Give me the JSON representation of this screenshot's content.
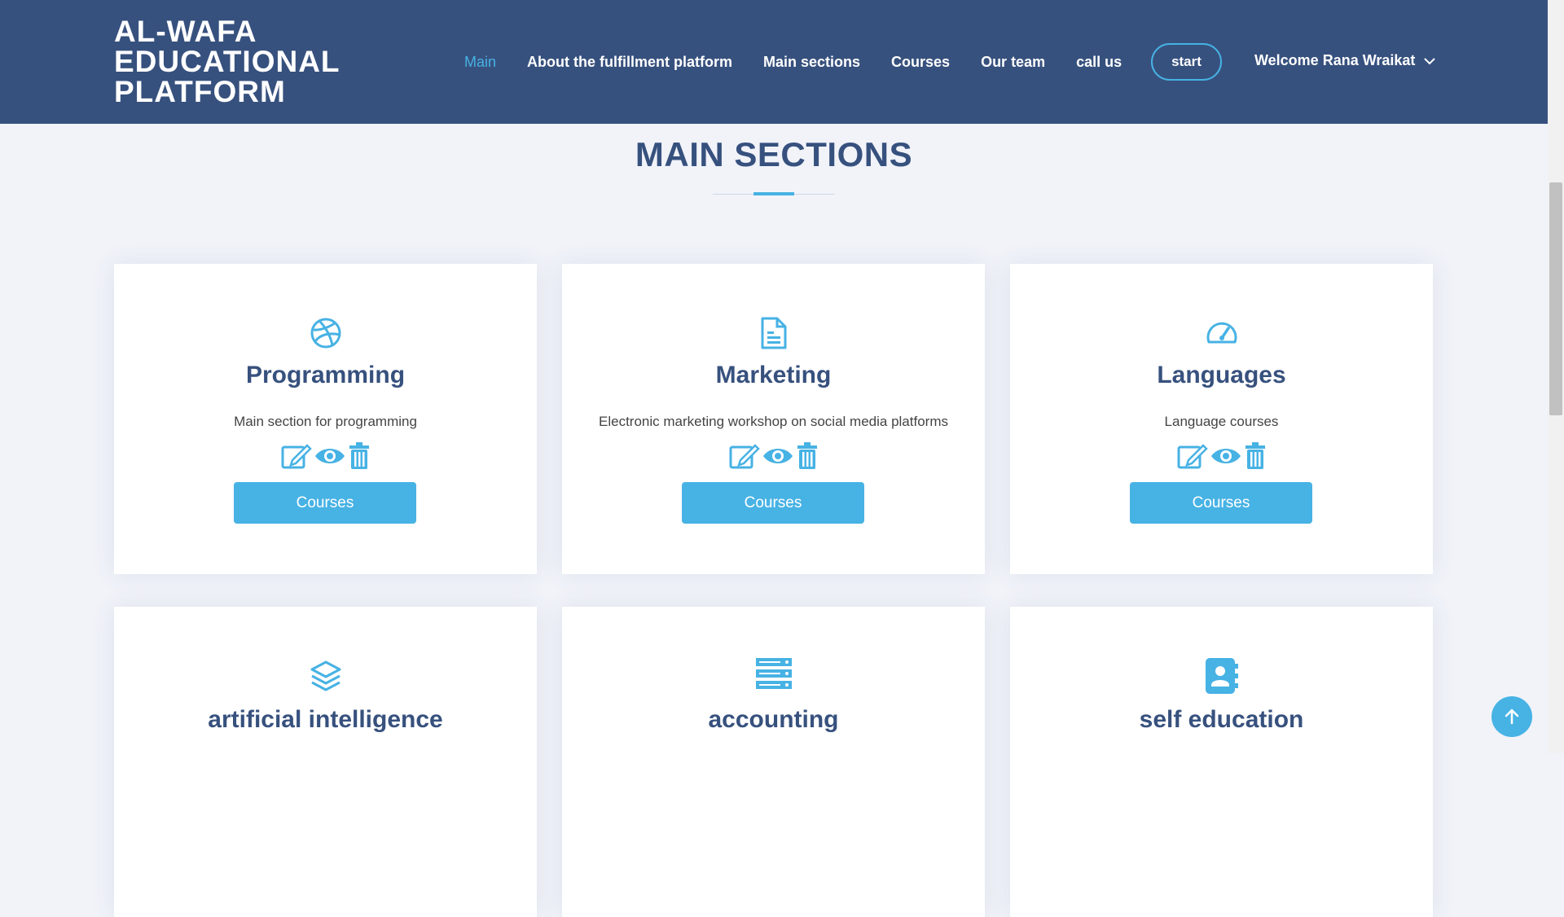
{
  "brand": {
    "lines": [
      "AL-WAFA",
      "EDUCATIONAL",
      "PLATFORM"
    ]
  },
  "nav": {
    "items": [
      {
        "label": "Main",
        "active": true
      },
      {
        "label": "About the fulfillment platform",
        "active": false
      },
      {
        "label": "Main sections",
        "active": false
      },
      {
        "label": "Courses",
        "active": false
      },
      {
        "label": "Our team",
        "active": false
      },
      {
        "label": "call us",
        "active": false
      }
    ],
    "start_label": "start",
    "welcome_label": "Welcome Rana Wraikat"
  },
  "section": {
    "title": "MAIN SECTIONS"
  },
  "cards": [
    {
      "title": "Programming",
      "description": "Main section for programming",
      "button": "Courses",
      "icon": "dribbble-icon"
    },
    {
      "title": "Marketing",
      "description": "Electronic marketing workshop on social media platforms",
      "button": "Courses",
      "icon": "file-text-icon"
    },
    {
      "title": "Languages",
      "description": "Language courses",
      "button": "Courses",
      "icon": "speedometer-icon"
    },
    {
      "title": "artificial intelligence",
      "icon": "layers-icon"
    },
    {
      "title": "accounting",
      "icon": "server-icon"
    },
    {
      "title": "self education",
      "icon": "contact-book-icon"
    }
  ],
  "colors": {
    "header": "#37517e",
    "accent": "#47b2e4",
    "background": "#f1f3f9",
    "title": "#37517e"
  }
}
